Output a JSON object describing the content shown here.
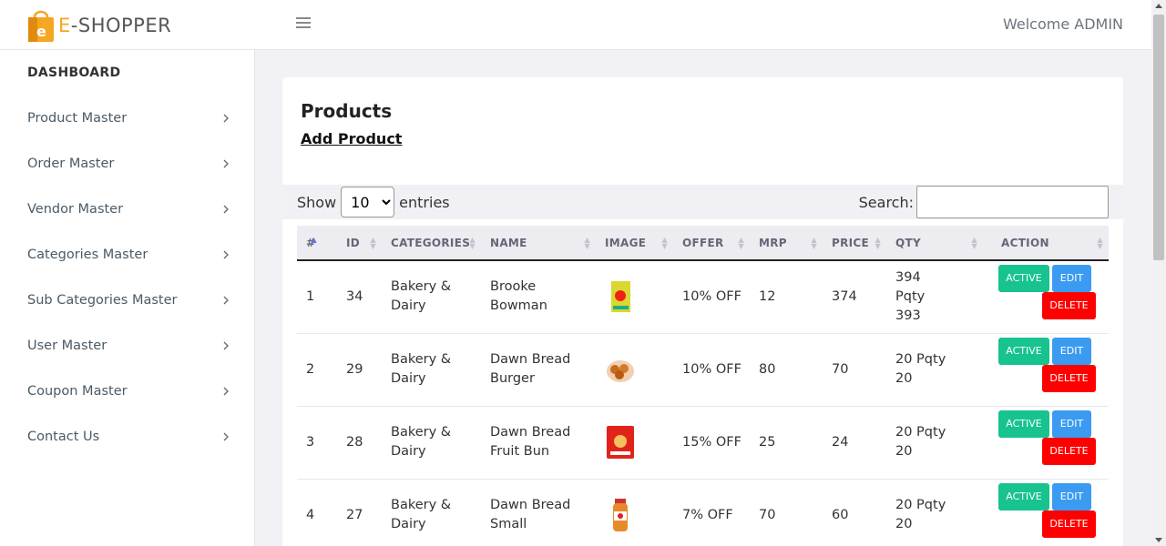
{
  "header": {
    "logo_letter": "e",
    "logo_first": "E",
    "logo_rest": "-SHOPPER",
    "welcome": "Welcome ADMIN"
  },
  "sidebar": {
    "dashboard": "DASHBOARD",
    "items": [
      {
        "label": "Product Master"
      },
      {
        "label": "Order Master"
      },
      {
        "label": "Vendor Master"
      },
      {
        "label": "Categories Master"
      },
      {
        "label": "Sub Categories Master"
      },
      {
        "label": "User Master"
      },
      {
        "label": "Coupon Master"
      },
      {
        "label": "Contact Us"
      }
    ]
  },
  "main": {
    "title": "Products",
    "add_link": "Add Product",
    "show_label": "Show",
    "entries_value": "10",
    "entries_label": "entries",
    "search_label": "Search:"
  },
  "table": {
    "headers": [
      "#",
      "ID",
      "CATEGORIES",
      "NAME",
      "IMAGE",
      "OFFER",
      "MRP",
      "PRICE",
      "QTY",
      "ACTION"
    ],
    "rows": [
      {
        "num": "1",
        "id": "34",
        "category": "Bakery & Dairy",
        "name": "Brooke Bowman",
        "offer": "10% OFF",
        "mrp": "12",
        "price": "374",
        "qty": "394 Pqty 393"
      },
      {
        "num": "2",
        "id": "29",
        "category": "Bakery & Dairy",
        "name": "Dawn Bread Burger",
        "offer": "10% OFF",
        "mrp": "80",
        "price": "70",
        "qty": "20 Pqty 20"
      },
      {
        "num": "3",
        "id": "28",
        "category": "Bakery & Dairy",
        "name": "Dawn Bread Fruit Bun",
        "offer": "15% OFF",
        "mrp": "25",
        "price": "24",
        "qty": "20 Pqty 20"
      },
      {
        "num": "4",
        "id": "27",
        "category": "Bakery & Dairy",
        "name": "Dawn Bread Small",
        "offer": "7% OFF",
        "mrp": "70",
        "price": "60",
        "qty": "20 Pqty 20"
      }
    ],
    "btn_active": "ACTIVE",
    "btn_edit": "EDIT",
    "btn_delete": "DELETE"
  },
  "colors": {
    "accent_orange": "#f5a623",
    "active_green": "#17c38f",
    "edit_blue": "#3a9bf0",
    "delete_red": "#ff0000"
  },
  "icons": [
    "shopping-bag-icon",
    "hamburger-icon",
    "chevron-right-icon",
    "sort-icon",
    "product-image-icon"
  ]
}
